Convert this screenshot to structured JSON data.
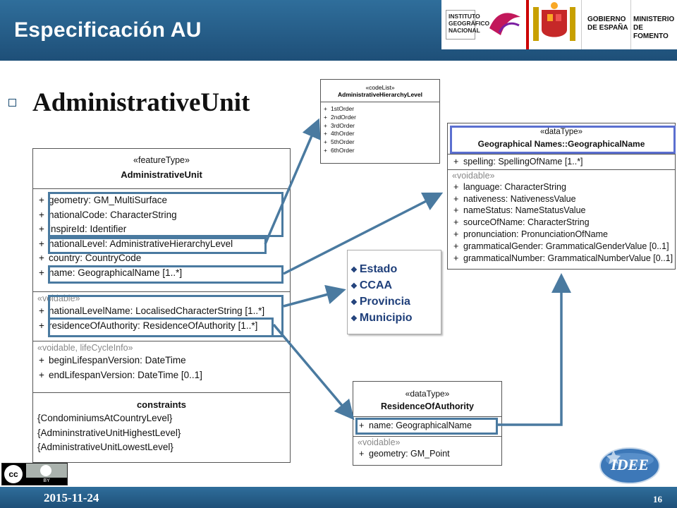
{
  "header": {
    "title": "Especificación AU",
    "logo_ign_lines": [
      "INSTITUTO",
      "GEOGRÁFICO",
      "NACIONAL"
    ],
    "logo_gob_lines": [
      "GOBIERNO",
      "DE ESPAÑA"
    ],
    "logo_min_lines": [
      "MINISTERIO",
      "DE FOMENTO"
    ]
  },
  "heading": "AdministrativeUnit",
  "admin_unit": {
    "stereotype": "«featureType»",
    "name": "AdministrativeUnit",
    "attributes": [
      "geometry: GM_MultiSurface",
      "nationalCode: CharacterString",
      "inspireId: Identifier",
      "nationalLevel: AdministrativeHierarchyLevel",
      "country: CountryCode",
      "name: GeographicalName [1..*]"
    ],
    "voidable_label": "«voidable»",
    "voidable_attributes": [
      "nationalLevelName: LocalisedCharacterString [1..*]",
      "residenceOfAuthority: ResidenceOfAuthority [1..*]"
    ],
    "lifecycle_label": "«voidable, lifeCycleInfo»",
    "lifecycle_attributes": [
      "beginLifespanVersion: DateTime",
      "endLifespanVersion: DateTime [0..1]"
    ],
    "constraints_title": "constraints",
    "constraints": [
      "{CondominiumsAtCountryLevel}",
      "{AdmininstrativeUnitHighestLevel}",
      "{AdministrativeUnitLowestLevel}"
    ],
    "plus": "+"
  },
  "codelist": {
    "stereotype": "«codeList»",
    "name": "AdministrativeHierarchyLevel",
    "values": [
      "1stOrder",
      "2ndOrder",
      "3rdOrder",
      "4thOrder",
      "5thOrder",
      "6thOrder"
    ]
  },
  "geo_name": {
    "stereotype": "«dataType»",
    "name": "Geographical Names::GeographicalName",
    "attributes": [
      "spelling: SpellingOfName [1..*]"
    ],
    "voidable_label": "«voidable»",
    "voidable_attributes": [
      "language: CharacterString",
      "nativeness: NativenessValue",
      "nameStatus: NameStatusValue",
      "sourceOfName: CharacterString",
      "pronunciation: PronunciationOfName",
      "grammaticalGender: GrammaticalGenderValue [0..1]",
      "grammaticalNumber: GrammaticalNumberValue [0..1]"
    ]
  },
  "level_values": [
    "Estado",
    "CCAA",
    "Provincia",
    "Municipio"
  ],
  "residence": {
    "stereotype": "«dataType»",
    "name": "ResidenceOfAuthority",
    "attributes": [
      "name: GeographicalName"
    ],
    "voidable_label": "«voidable»",
    "voidable_attributes": [
      "geometry: GM_Point"
    ]
  },
  "footer": {
    "date": "2015-11-24",
    "page": "16",
    "cc_label": "BY",
    "idee_label": "IDEE"
  },
  "colors": {
    "header_blue": "#2a6591",
    "arrow": "#4a7aa0",
    "values_text": "#1f3f7a"
  }
}
